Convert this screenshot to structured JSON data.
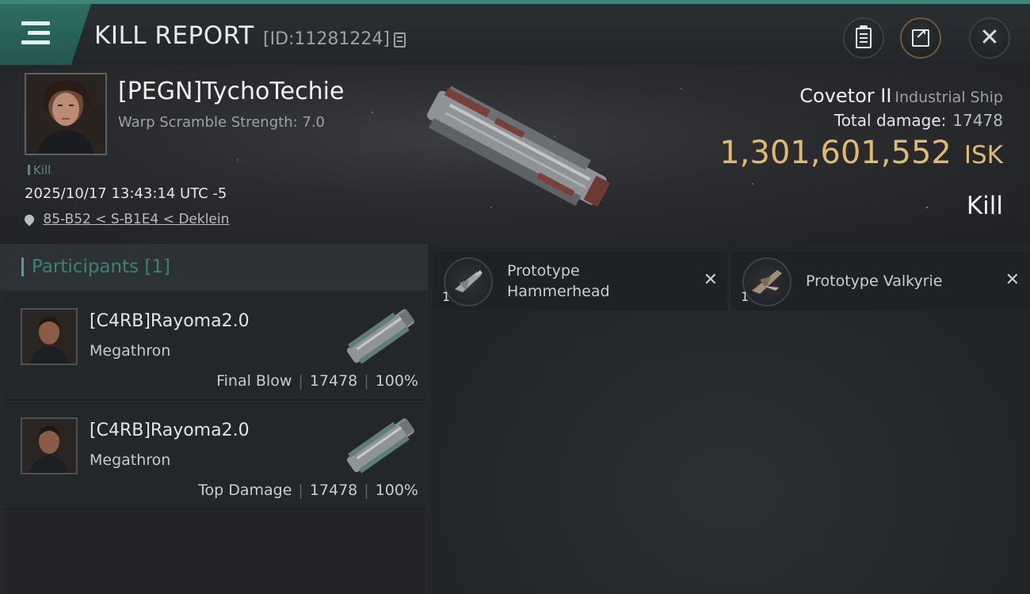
{
  "header": {
    "title": "KILL REPORT",
    "report_id": "[ID:11281224]"
  },
  "victim": {
    "name": "[PEGN]TychoTechie",
    "scramble": "Warp Scramble Strength: 7.0",
    "tag": "Kill",
    "datetime": "2025/10/17 13:43:14 UTC -5",
    "location": "85-B52 < S-B1E4 < Deklein",
    "ship_name": "Covetor II",
    "ship_class": "Industrial Ship",
    "total_damage_label": "Total damage:",
    "total_damage": "17478",
    "isk_value": "1,301,601,552",
    "isk_unit": "ISK",
    "result": "Kill"
  },
  "participants": {
    "title": "Participants",
    "count": "[1]",
    "rows": [
      {
        "name": "[C4RB]Rayoma2.0",
        "ship": "Megathron",
        "role": "Final Blow",
        "damage": "17478",
        "percent": "100%"
      },
      {
        "name": "[C4RB]Rayoma2.0",
        "ship": "Megathron",
        "role": "Top Damage",
        "damage": "17478",
        "percent": "100%"
      }
    ]
  },
  "drones": [
    {
      "name": "Prototype Hammerhead",
      "count": "1"
    },
    {
      "name": "Prototype  Valkyrie",
      "count": "1"
    }
  ],
  "colors": {
    "accent": "#3f8577",
    "isk": "#e0ba6f",
    "participants_title": "#3f7f76"
  }
}
